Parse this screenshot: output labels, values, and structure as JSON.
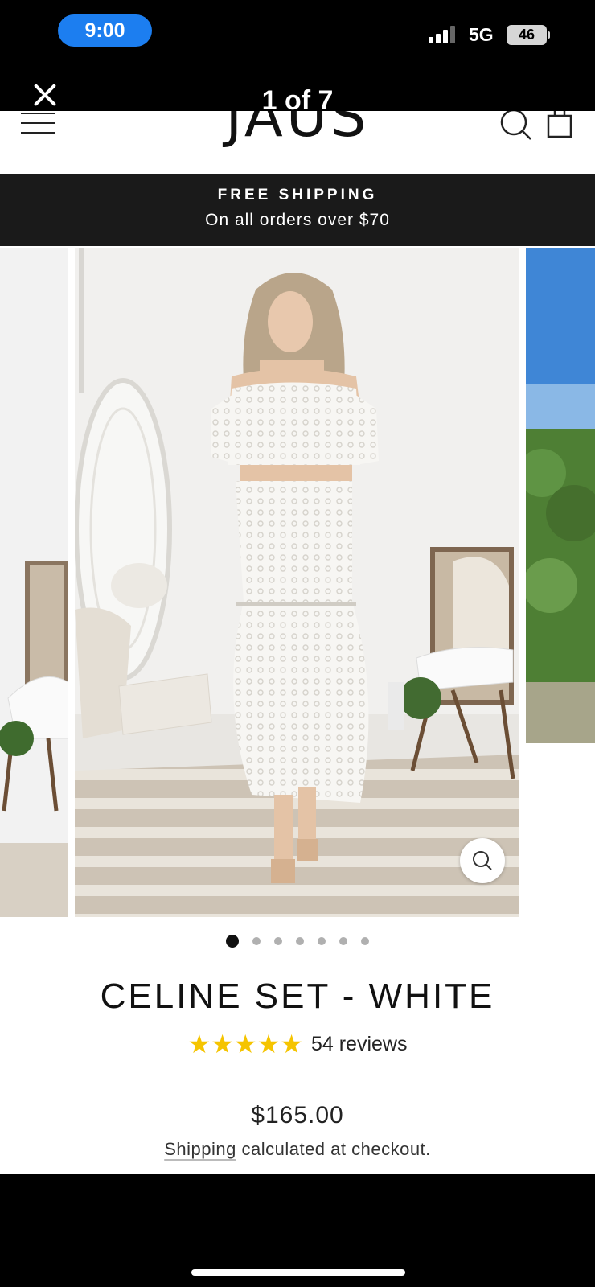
{
  "status_bar": {
    "time": "9:00",
    "network": "5G",
    "battery": "46"
  },
  "viewer": {
    "counter": "1 of 7"
  },
  "site": {
    "logo": "JAUS",
    "promo": {
      "title": "FREE SHIPPING",
      "subtitle": "On all orders over $70"
    }
  },
  "product": {
    "title": "CELINE SET - WHITE",
    "rating": 5,
    "reviews_label": "54 reviews",
    "price": "$165.00",
    "shipping_link": "Shipping",
    "shipping_rest": " calculated at checkout.",
    "image_count": 7,
    "current_image": 1
  },
  "colors": {
    "accent_blue": "#1c7ef0",
    "star": "#f5c400",
    "promo_bg": "#1a1a1a"
  }
}
